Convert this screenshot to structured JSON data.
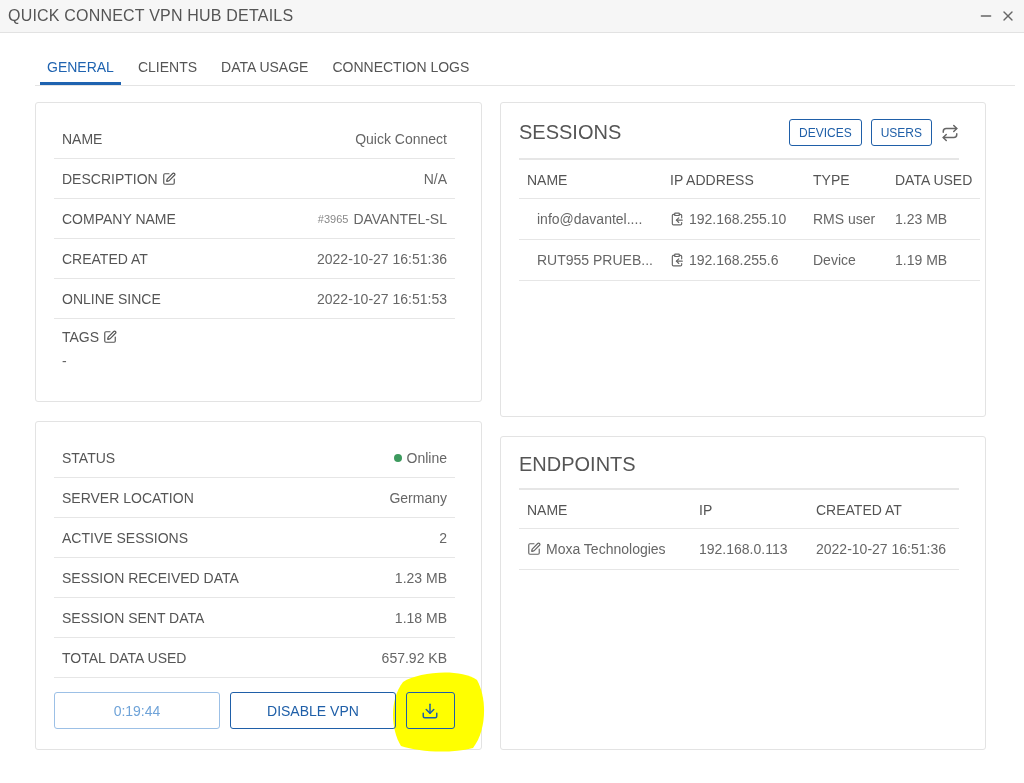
{
  "window": {
    "title": "QUICK CONNECT VPN HUB DETAILS"
  },
  "tabs": [
    {
      "label": "GENERAL",
      "selected": true
    },
    {
      "label": "CLIENTS",
      "selected": false
    },
    {
      "label": "DATA USAGE",
      "selected": false
    },
    {
      "label": "CONNECTION LOGS",
      "selected": false
    }
  ],
  "details": [
    {
      "kind": "inline",
      "label": "NAME",
      "editable": false,
      "value": "Quick Connect"
    },
    {
      "kind": "inline",
      "label": "DESCRIPTION",
      "editable": true,
      "value": "N/A"
    },
    {
      "kind": "inline",
      "label": "COMPANY NAME",
      "editable": false,
      "prefix": "#3965",
      "value": "DAVANTEL-SL"
    },
    {
      "kind": "inline",
      "label": "CREATED AT",
      "editable": false,
      "value": "2022-10-27 16:51:36"
    },
    {
      "kind": "inline",
      "label": "ONLINE SINCE",
      "editable": false,
      "value": "2022-10-27 16:51:53"
    },
    {
      "kind": "stacked",
      "label": "TAGS",
      "editable": true,
      "value": "-"
    }
  ],
  "status": [
    {
      "label": "STATUS",
      "value": "Online",
      "color": "#3d9a5e"
    },
    {
      "label": "SERVER LOCATION",
      "value": "Germany"
    },
    {
      "label": "ACTIVE SESSIONS",
      "value": "2"
    },
    {
      "label": "SESSION RECEIVED DATA",
      "value": "1.23 MB"
    },
    {
      "label": "SESSION SENT DATA",
      "value": "1.18 MB"
    },
    {
      "label": "TOTAL DATA USED",
      "value": "657.92 KB"
    }
  ],
  "actions": {
    "timer": {
      "label": "0:19:44",
      "disabled": true
    },
    "disable_button": "DISABLE VPN"
  },
  "sessions": {
    "title": "SESSIONS",
    "buttons": [
      "DEVICES",
      "USERS"
    ],
    "columns": [
      "NAME",
      "IP ADDRESS",
      "TYPE",
      "DATA USED"
    ],
    "rows": [
      {
        "name": "info@davantel....",
        "ip": "192.168.255.10",
        "type": "RMS user",
        "data_used": "1.23 MB"
      },
      {
        "name": "RUT955 PRUEB...",
        "ip": "192.168.255.6",
        "type": "Device",
        "data_used": "1.19 MB"
      }
    ]
  },
  "endpoints": {
    "title": "ENDPOINTS",
    "columns": [
      "NAME",
      "IP",
      "CREATED AT"
    ],
    "rows": [
      {
        "name": "Moxa Technologies",
        "ip": "192.168.0.113",
        "created_at": "2022-10-27 16:51:36"
      }
    ]
  }
}
